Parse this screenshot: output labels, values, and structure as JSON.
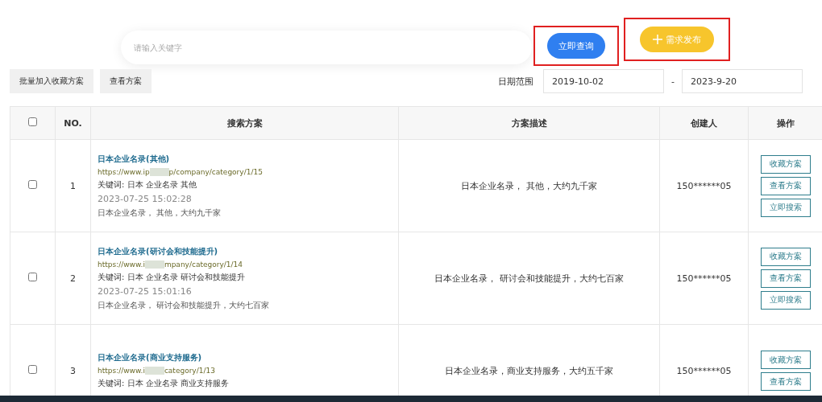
{
  "search": {
    "placeholder": "请输入关键字",
    "submit_label": "立即查询",
    "publish_label": "需求发布"
  },
  "toolbar": {
    "buttons": [
      "批量加入收藏方案",
      "查看方案"
    ],
    "date_label": "日期范围",
    "date_from": "2019-10-02",
    "date_separator": "-",
    "date_to": "2023-9-20"
  },
  "table": {
    "select_all_checked": false,
    "columns": [
      "NO.",
      "搜索方案",
      "方案描述",
      "创建人",
      "操作"
    ],
    "rows": [
      {
        "checked": false,
        "no": "1",
        "title": "日本企业名录(其他)",
        "url_start": "https://www.ip",
        "url_end": "p/company/category/1/15",
        "keywords": "关键词: 日本 企业名录 其他",
        "time": "2023-07-25 15:02:28",
        "summary": "日本企业名录， 其他，大约九千家",
        "description": "日本企业名录， 其他，大约九千家",
        "creator": "150******05",
        "actions": [
          "收藏方案",
          "查看方案",
          "立即搜索"
        ]
      },
      {
        "checked": false,
        "no": "2",
        "title": "日本企业名录(研讨会和技能提升)",
        "url_start": "https://www.i",
        "url_end": "mpany/category/1/14",
        "keywords": "关键词: 日本 企业名录 研讨会和技能提升",
        "time": "2023-07-25 15:01:16",
        "summary": "日本企业名录， 研讨会和技能提升，大约七百家",
        "description": "日本企业名录， 研讨会和技能提升，大约七百家",
        "creator": "150******05",
        "actions": [
          "收藏方案",
          "查看方案",
          "立即搜索"
        ]
      },
      {
        "checked": false,
        "no": "3",
        "title": "日本企业名录(商业支持服务)",
        "url_start": "https://www.i",
        "url_end": "category/1/13",
        "keywords": "关键词: 日本 企业名录 商业支持服务",
        "description": "日本企业名录，商业支持服务，大约五千家",
        "creator": "150******05",
        "actions": [
          "收藏方案",
          "查看方案"
        ]
      }
    ]
  }
}
